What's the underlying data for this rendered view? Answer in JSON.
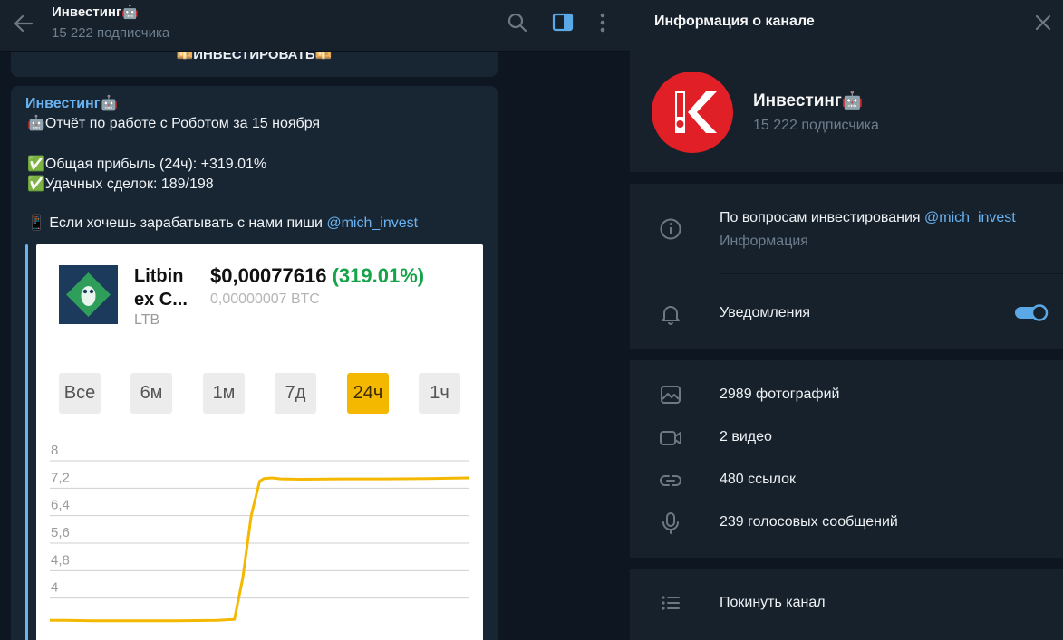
{
  "chat": {
    "title": "Инвестинг🤖",
    "subscribers": "15 222 подписчика",
    "prev_button_label": "💴ИНВЕСТИРОВАТЬ💴"
  },
  "message": {
    "author": "Инвестинг🤖",
    "line1": "🤖Отчёт по работе с Роботом за 15 ноября",
    "line2": "✅Общая прибыль (24ч): +319.01%",
    "line3": "✅Удачных сделок: 189/198",
    "line4_prefix": "📱 Если хочешь зарабатывать с нами пиши ",
    "line4_mention": "@mich_invest"
  },
  "card": {
    "coin_name": "Litbin ex C...",
    "coin_ticker": "LTB",
    "price": "$0,00077616",
    "change": "(319.01%)",
    "price_btc": "0,00000007 BTC",
    "ranges": [
      {
        "label": "Все",
        "active": false
      },
      {
        "label": "6м",
        "active": false
      },
      {
        "label": "1м",
        "active": false
      },
      {
        "label": "7д",
        "active": false
      },
      {
        "label": "24ч",
        "active": true
      },
      {
        "label": "1ч",
        "active": false
      }
    ]
  },
  "chart_data": {
    "type": "line",
    "title": "",
    "xlabel": "",
    "ylabel": "",
    "y_ticks": [
      "8",
      "7,2",
      "6,4",
      "5,6",
      "4,8",
      "4"
    ],
    "ylim": [
      3.2,
      8
    ],
    "grid": true,
    "series": [
      {
        "color": "#f5b800",
        "x": [
          0,
          0.04,
          0.1,
          0.2,
          0.3,
          0.4,
          0.44,
          0.46,
          0.48,
          0.5,
          0.51,
          0.53,
          0.55,
          0.6,
          0.7,
          0.8,
          0.9,
          1.0
        ],
        "y": [
          3.35,
          3.35,
          3.34,
          3.34,
          3.34,
          3.35,
          3.38,
          4.6,
          6.4,
          7.4,
          7.48,
          7.5,
          7.47,
          7.46,
          7.47,
          7.47,
          7.48,
          7.5
        ]
      }
    ]
  },
  "info": {
    "header_title": "Информация о канале",
    "channel_name": "Инвестинг🤖",
    "channel_subs": "15 222 подписчика",
    "about_prefix": "По вопросам инвестирования ",
    "about_mention": "@mich_invest",
    "about_label": "Информация",
    "notifications_label": "Уведомления",
    "notifications_on": true,
    "photos": "2989 фотографий",
    "videos": "2 видео",
    "links": "480 ссылок",
    "voice": "239 голосовых сообщений",
    "leave": "Покинуть канал"
  },
  "colors": {
    "accent": "#6ab3f3",
    "panel": "#17212b",
    "background": "#0e1621",
    "avatar": "#e01f26",
    "chart_line": "#f5b800",
    "positive": "#16a34a"
  }
}
